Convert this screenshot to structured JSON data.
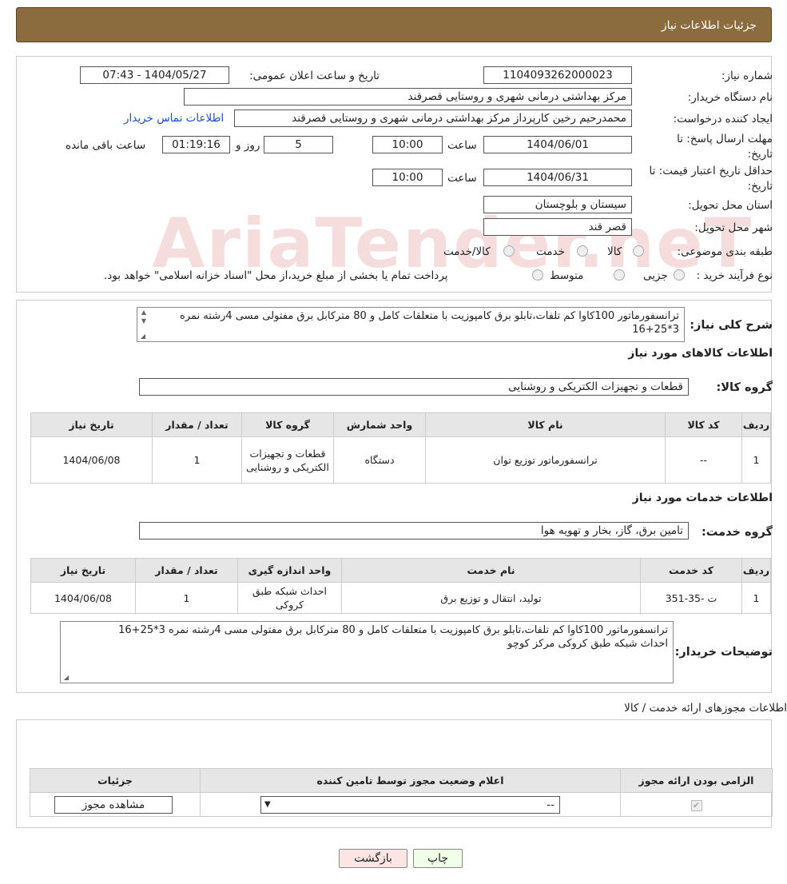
{
  "header": {
    "title": "جزئیات اطلاعات نیاز"
  },
  "watermark": "AriaTender.neT",
  "info": {
    "need_number_label": "شماره نیاز:",
    "need_number": "1104093262000023",
    "announce_label": "تاریخ و ساعت اعلان عمومی:",
    "announce_value": "1404/05/27 - 07:43",
    "buyer_label": "نام دستگاه خریدار:",
    "buyer_value": "مرکز بهداشتی درمانی شهری و روستایی قصرقند",
    "creator_label": "ایجاد کننده درخواست:",
    "creator_value": "محمدرحیم رخین کارپرداز مرکز بهداشتی درمانی شهری و روستایی قصرقند",
    "contact_link": "اطلاعات تماس خریدار",
    "deadline_label": "مهلت ارسال پاسخ: تا تاریخ:",
    "deadline_date": "1404/06/01",
    "time_label": "ساعت",
    "deadline_time": "10:00",
    "days_value": "5",
    "days_label": "روز و",
    "remaining_time": "01:19:16",
    "remaining_label": "ساعت باقی مانده",
    "validity_label": "حداقل تاریخ اعتبار قیمت: تا تاریخ:",
    "validity_date": "1404/06/31",
    "validity_time_label": "ساعت",
    "validity_time": "10:00",
    "province_label": "استان محل تحویل:",
    "province_value": "سیستان و بلوچستان",
    "city_label": "شهر محل تحویل:",
    "city_value": "قصر قند",
    "category_label": "طبقه بندی موضوعی:",
    "cat_goods": "کالا",
    "cat_service": "خدمت",
    "cat_both": "کالا/خدمت",
    "process_label": "نوع فرآیند خرید :",
    "proc_partial": "جزیی",
    "proc_medium": "متوسط",
    "proc_note": "پرداخت تمام یا بخشی از مبلغ خرید،از محل \"اسناد خزانه اسلامی\" خواهد بود."
  },
  "summary": {
    "label": "شرح کلی نیاز:",
    "text": "ترانسفورماتور 100کاوا کم تلفات،تابلو برق کامپوزیت با متعلقات کامل و 80 مترکابل برق مفتولی مسی 4رشته نمره 3*25+16"
  },
  "goods": {
    "section_title": "اطلاعات کالاهای مورد نیاز",
    "group_label": "گروه کالا:",
    "group_value": "قطعات و تجهیزات الکتریکی و روشنایی",
    "columns": [
      "ردیف",
      "کد کالا",
      "نام کالا",
      "واحد شمارش",
      "گروه کالا",
      "تعداد / مقدار",
      "تاریخ نیاز"
    ],
    "rows": [
      [
        "1",
        "--",
        "ترانسفورماتور توزیع توان",
        "دستگاه",
        "قطعات و تجهیزات الکتریکی و روشنایی",
        "1",
        "1404/06/08"
      ]
    ]
  },
  "services": {
    "section_title": "اطلاعات خدمات مورد نیاز",
    "group_label": "گروه خدمت:",
    "group_value": "تامین برق، گاز، بخار و تهویه هوا",
    "columns": [
      "ردیف",
      "کد خدمت",
      "نام خدمت",
      "واحد اندازه گیری",
      "تعداد / مقدار",
      "تاریخ نیاز"
    ],
    "rows": [
      [
        "1",
        "ت -35-351",
        "تولید، انتقال و توزیع برق",
        "احداث شبکه طبق کروکی",
        "1",
        "1404/06/08"
      ]
    ]
  },
  "buyer_notes": {
    "label": "توضیحات خریدار:",
    "line1": "ترانسفورماتور 100کاوا کم تلفات،تابلو برق کامپوزیت با متعلقات کامل و 80 مترکابل برق مفتولی مسی 4رشته نمره 3*25+16",
    "line2": "احداث شبکه طبق کروکی مرکز کوچو"
  },
  "permits": {
    "title": "اطلاعات مجوزهای ارائه خدمت / کالا",
    "columns": [
      "الزامی بودن ارائه مجوز",
      "اعلام وضعیت مجوز توسط تامین کننده",
      "جزئیات"
    ],
    "select_value": "--",
    "view_button": "مشاهده مجوز"
  },
  "buttons": {
    "print": "چاپ",
    "back": "بازگشت"
  }
}
